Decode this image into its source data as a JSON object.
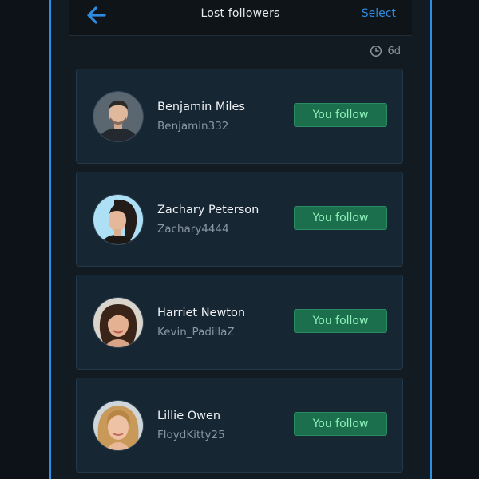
{
  "header": {
    "title": "Lost followers",
    "select_label": "Select"
  },
  "timeframe": {
    "label": "6d",
    "icon": "clock-icon"
  },
  "colors": {
    "accent": "#2e8be0",
    "follow_button_bg": "#1c6f4d",
    "follow_text": "#8ff0bb"
  },
  "users": [
    {
      "name": "Benjamin Miles",
      "handle": "Benjamin332",
      "button": "You follow"
    },
    {
      "name": "Zachary Peterson",
      "handle": "Zachary4444",
      "button": "You follow"
    },
    {
      "name": "Harriet Newton",
      "handle": "Kevin_PadillaZ",
      "button": "You follow"
    },
    {
      "name": "Lillie Owen",
      "handle": "FloydKitty25",
      "button": "You follow"
    }
  ]
}
